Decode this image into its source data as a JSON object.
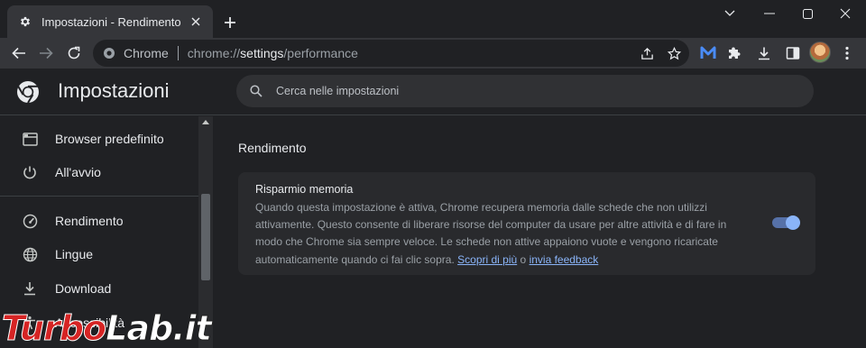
{
  "tab": {
    "title": "Impostazioni - Rendimento",
    "favicon": "gear-icon"
  },
  "omnibox": {
    "site": "Chrome",
    "url_scheme": "chrome://",
    "url_host": "settings",
    "url_path": "/performance"
  },
  "header": {
    "title": "Impostazioni",
    "search_placeholder": "Cerca nelle impostazioni"
  },
  "sidebar": {
    "items": [
      {
        "label": "Browser predefinito",
        "icon": "browser-icon"
      },
      {
        "label": "All'avvio",
        "icon": "power-icon"
      },
      {
        "label": "Rendimento",
        "icon": "speedometer-icon"
      },
      {
        "label": "Lingue",
        "icon": "globe-icon"
      },
      {
        "label": "Download",
        "icon": "download-icon"
      },
      {
        "label": "Accessibilità",
        "icon": "accessibility-icon"
      }
    ]
  },
  "main": {
    "section_title": "Rendimento",
    "card": {
      "title": "Risparmio memoria",
      "description": "Quando questa impostazione è attiva, Chrome recupera memoria dalle schede che non utilizzi attivamente. Questo consente di liberare risorse del computer da usare per altre attività e di fare in modo che Chrome sia sempre veloce. Le schede non attive appaiono vuote e vengono ricaricate automaticamente quando ci fai clic sopra.",
      "link_more": "Scopri di più",
      "link_sep": "o",
      "link_feedback": "invia feedback",
      "toggle_on": true
    }
  },
  "watermark": {
    "part1": "Turbo",
    "part2": "Lab.it"
  },
  "colors": {
    "accent": "#8ab4f8",
    "background": "#202124",
    "card": "#292a2d"
  }
}
